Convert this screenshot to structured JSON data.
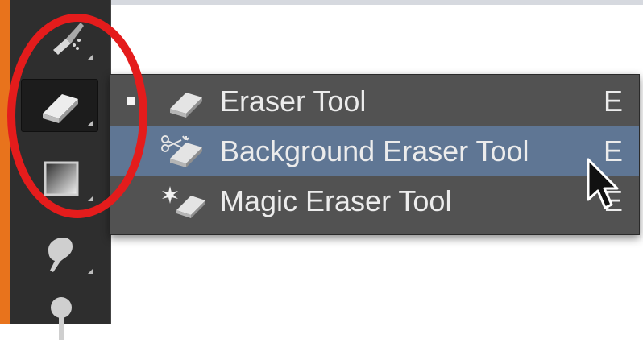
{
  "colors": {
    "toolbar_bg": "#2e2e2e",
    "flyout_bg": "#525252",
    "selected_bg": "#5f7694",
    "highlight_circle": "#e41c1c",
    "side_strip": "#e8731c"
  },
  "toolbar": {
    "tools": [
      {
        "icon": "brush-icon"
      },
      {
        "icon": "eraser-icon",
        "active": true
      },
      {
        "icon": "gradient-icon"
      },
      {
        "icon": "smudge-icon"
      },
      {
        "icon": "dodge-icon"
      }
    ]
  },
  "flyout": {
    "items": [
      {
        "label": "Eraser Tool",
        "shortcut": "E",
        "icon": "eraser-icon",
        "current": true
      },
      {
        "label": "Background Eraser Tool",
        "shortcut": "E",
        "icon": "background-eraser-icon",
        "hovered": true
      },
      {
        "label": "Magic Eraser Tool",
        "shortcut": "E",
        "icon": "magic-eraser-icon"
      }
    ]
  }
}
